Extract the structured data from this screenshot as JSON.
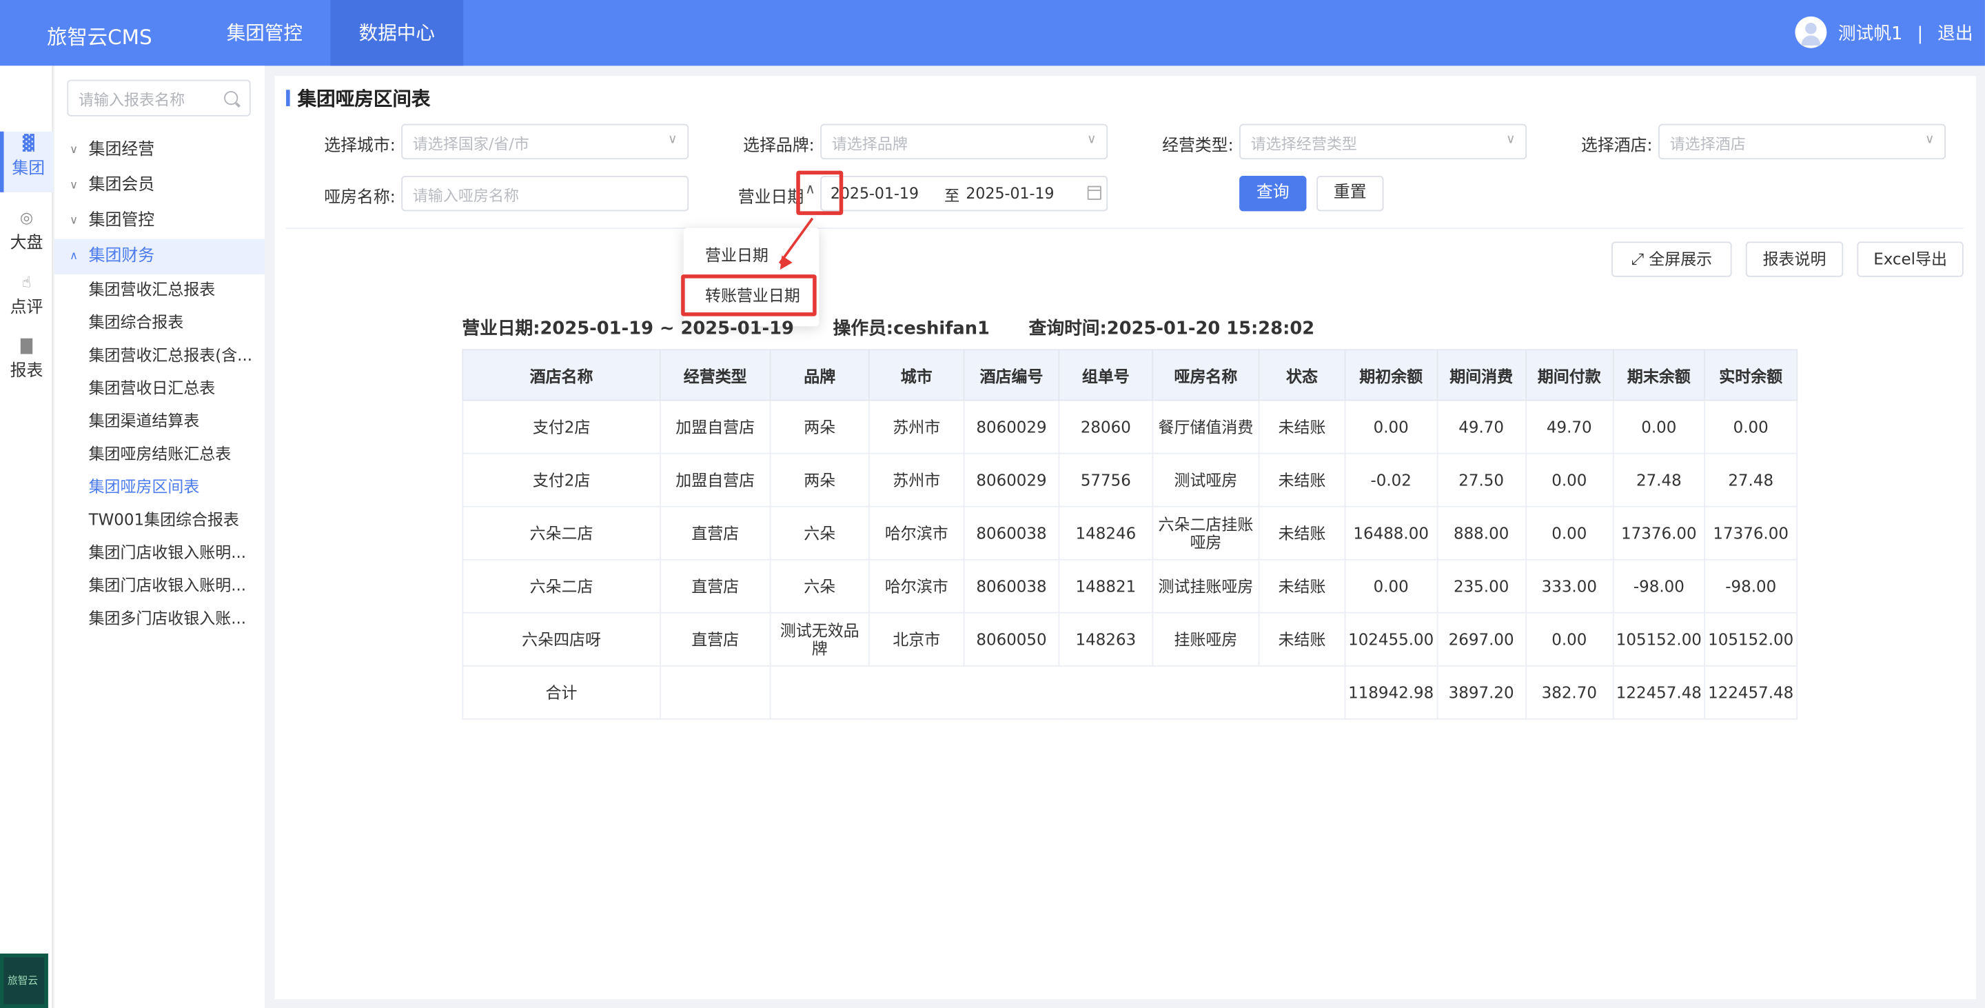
{
  "header": {
    "brand": "旅智云CMS",
    "nav": [
      "集团管控",
      "数据中心"
    ],
    "active_nav": "数据中心",
    "user": "测试帆1",
    "sep": "|",
    "logout": "退出"
  },
  "rail": {
    "items": [
      {
        "label": "集团",
        "icon": "building-icon"
      },
      {
        "label": "大盘",
        "icon": "target-icon"
      },
      {
        "label": "点评",
        "icon": "thumbs-up-icon"
      },
      {
        "label": "报表",
        "icon": "bar-chart-icon"
      }
    ],
    "logo_text": "旅智云"
  },
  "sidebar": {
    "search_placeholder": "请输入报表名称",
    "groups": [
      "集团经营",
      "集团会员",
      "集团管控",
      "集团财务"
    ],
    "items": [
      "集团营收汇总报表",
      "集团综合报表",
      "集团营收汇总报表(含...",
      "集团营收日汇总表",
      "集团渠道结算表",
      "集团哑房结账汇总表",
      "集团哑房区间表",
      "TW001集团综合报表",
      "集团门店收银入账明...",
      "集团门店收银入账明...",
      "集团多门店收银入账..."
    ],
    "active_item": "集团哑房区间表"
  },
  "page": {
    "title": "集团哑房区间表",
    "filters": {
      "city_label": "选择城市:",
      "city_placeholder": "请选择国家/省/市",
      "brand_label": "选择品牌:",
      "brand_placeholder": "请选择品牌",
      "biz_type_label": "经营类型:",
      "biz_type_placeholder": "请选择经营类型",
      "hotel_label": "选择酒店:",
      "hotel_placeholder": "请选择酒店",
      "room_label": "哑房名称:",
      "room_placeholder": "请输入哑房名称",
      "date_type_label": "营业日期",
      "date_from": "2025-01-19",
      "date_to_label": "至",
      "date_to": "2025-01-19",
      "query_button": "查询",
      "reset_button": "重置"
    },
    "date_type_options": [
      "营业日期",
      "转账营业日期"
    ],
    "toolbar": {
      "fullscreen": "全屏展示",
      "explain": "报表说明",
      "export": "Excel导出"
    },
    "report_meta": {
      "date": "营业日期:2025-01-19 ~ 2025-01-19",
      "operator": "操作员:ceshifan1",
      "query_time": "查询时间:2025-01-20 15:28:02"
    },
    "table": {
      "headers": [
        "酒店名称",
        "经营类型",
        "品牌",
        "城市",
        "酒店编号",
        "组单号",
        "哑房名称",
        "状态",
        "期初余额",
        "期间消费",
        "期间付款",
        "期末余额",
        "实时余额"
      ],
      "rows": [
        [
          "支付2店",
          "加盟自营店",
          "两朵",
          "苏州市",
          "8060029",
          "28060",
          "餐厅储值消费",
          "未结账",
          "0.00",
          "49.70",
          "49.70",
          "0.00",
          "0.00"
        ],
        [
          "支付2店",
          "加盟自营店",
          "两朵",
          "苏州市",
          "8060029",
          "57756",
          "测试哑房",
          "未结账",
          "-0.02",
          "27.50",
          "0.00",
          "27.48",
          "27.48"
        ],
        [
          "六朵二店",
          "直营店",
          "六朵",
          "哈尔滨市",
          "8060038",
          "148246",
          "六朵二店挂账哑房",
          "未结账",
          "16488.00",
          "888.00",
          "0.00",
          "17376.00",
          "17376.00"
        ],
        [
          "六朵二店",
          "直营店",
          "六朵",
          "哈尔滨市",
          "8060038",
          "148821",
          "测试挂账哑房",
          "未结账",
          "0.00",
          "235.00",
          "333.00",
          "-98.00",
          "-98.00"
        ],
        [
          "六朵四店呀",
          "直营店",
          "测试无效品牌",
          "北京市",
          "8060050",
          "148263",
          "挂账哑房",
          "未结账",
          "102455.00",
          "2697.00",
          "0.00",
          "105152.00",
          "105152.00"
        ]
      ],
      "total": {
        "label": "合计",
        "values": [
          "118942.98",
          "3897.20",
          "382.70",
          "122457.48",
          "122457.48"
        ]
      }
    }
  }
}
